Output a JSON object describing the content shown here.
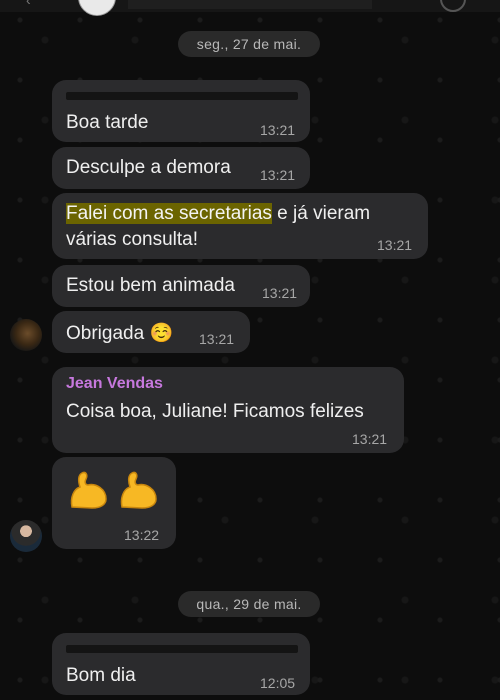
{
  "chat": {
    "dates": [
      "seg., 27 de mai.",
      "qua., 29 de mai."
    ],
    "messages": [
      {
        "text": "Boa tarde",
        "time": "13:21"
      },
      {
        "text": "Desculpe a demora",
        "time": "13:21"
      },
      {
        "text_highlight": "Falei com as secretarias",
        "text_rest": " e já vieram",
        "text_line2": "várias consulta!",
        "time": "13:21"
      },
      {
        "text": "Estou bem animada",
        "time": "13:21"
      },
      {
        "text": "Obrigada",
        "emoji": "☺️",
        "time": "13:21"
      },
      {
        "sender": "Jean Vendas",
        "text": "Coisa boa, Juliane! Ficamos felizes",
        "time": "13:21"
      },
      {
        "emoji": "💪💪",
        "time": "13:22"
      },
      {
        "text": "Bom dia",
        "time": "12:05"
      }
    ]
  },
  "colors": {
    "background": "#0b0b0b",
    "bubble": "#2b2b2d",
    "sender_name": "#c678dd",
    "highlight": "#6b6400",
    "date_pill": "#2a2a2a"
  },
  "icons": {
    "arm_emoji": "flexed-biceps-icon",
    "smile_emoji": "smiling-face-icon"
  }
}
